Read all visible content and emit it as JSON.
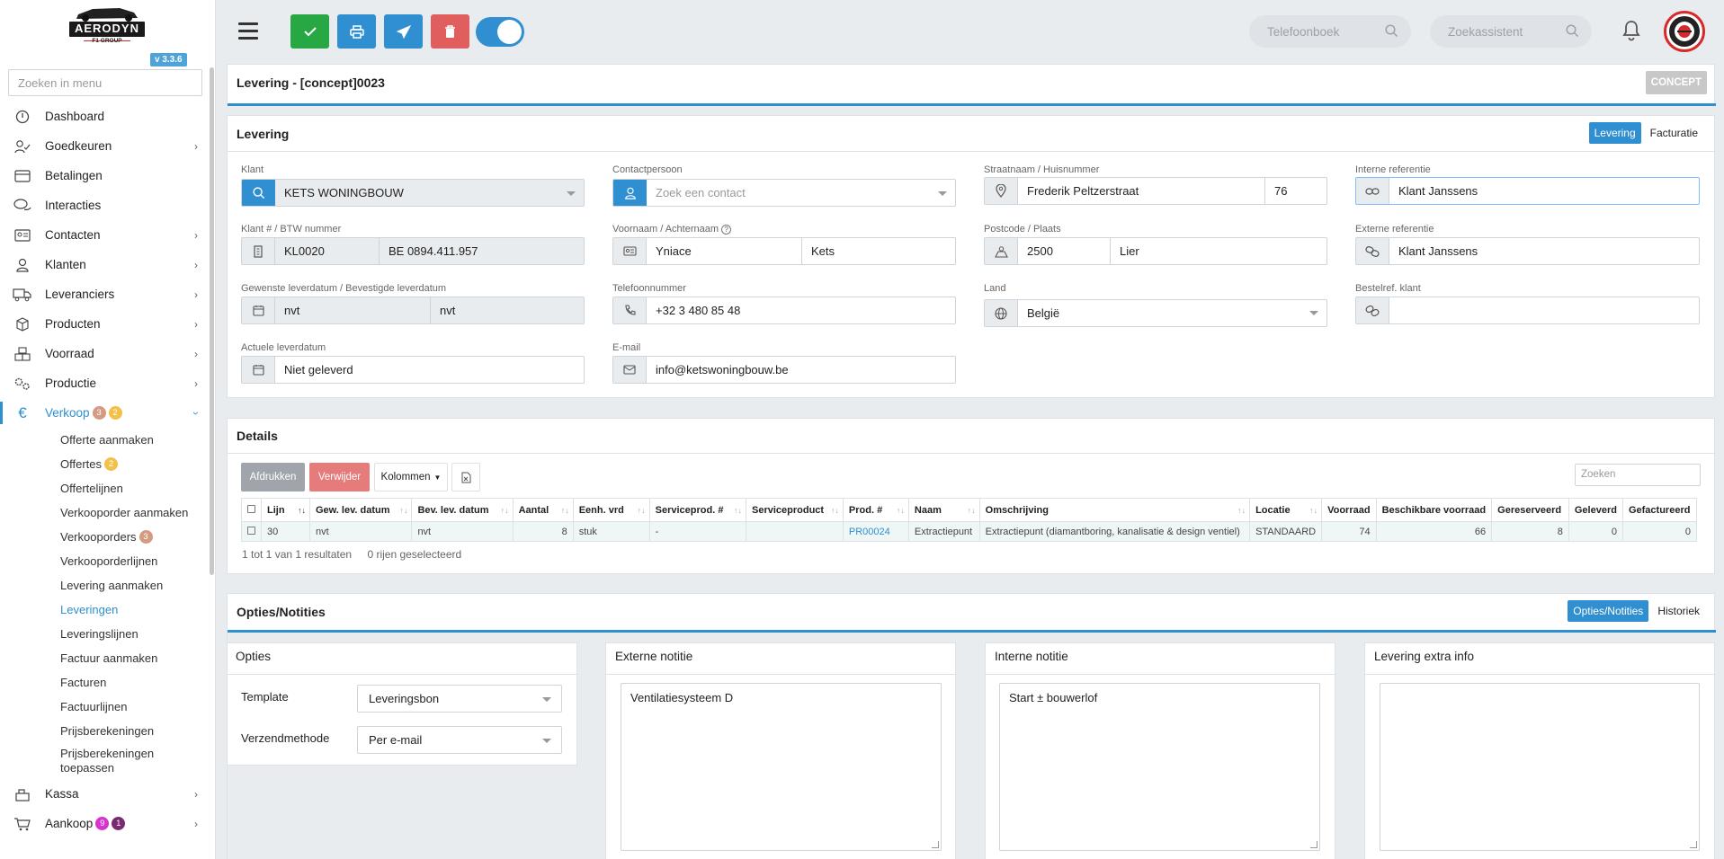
{
  "app": {
    "logo_text": "AERODYN",
    "logo_sub": "F1 GROUP",
    "version": "v 3.3.6",
    "menu_search_placeholder": "Zoeken in menu"
  },
  "nav": [
    {
      "label": "Dashboard",
      "icon": "dashboard-icon",
      "chevron": false
    },
    {
      "label": "Goedkeuren",
      "icon": "approve-user-icon",
      "chevron": true
    },
    {
      "label": "Betalingen",
      "icon": "credit-card-icon",
      "chevron": false
    },
    {
      "label": "Interacties",
      "icon": "chat-icon",
      "chevron": false
    },
    {
      "label": "Contacten",
      "icon": "contact-card-icon",
      "chevron": true
    },
    {
      "label": "Klanten",
      "icon": "user-icon",
      "chevron": true
    },
    {
      "label": "Leveranciers",
      "icon": "truck-icon",
      "chevron": true
    },
    {
      "label": "Producten",
      "icon": "box-icon",
      "chevron": true
    },
    {
      "label": "Voorraad",
      "icon": "boxes-icon",
      "chevron": true
    },
    {
      "label": "Productie",
      "icon": "gears-icon",
      "chevron": true
    }
  ],
  "verkoop": {
    "label": "Verkoop",
    "badge1": "3",
    "badge2": "2",
    "items": [
      {
        "label": "Offerte aanmaken"
      },
      {
        "label": "Offertes",
        "badge": "2",
        "badge_color": "yellow"
      },
      {
        "label": "Offertelijnen"
      },
      {
        "label": "Verkooporder aanmaken"
      },
      {
        "label": "Verkooporders",
        "badge": "3",
        "badge_color": "brown"
      },
      {
        "label": "Verkooporderlijnen"
      },
      {
        "label": "Levering aanmaken"
      },
      {
        "label": "Leveringen",
        "current": true
      },
      {
        "label": "Leveringslijnen"
      },
      {
        "label": "Factuur aanmaken"
      },
      {
        "label": "Facturen"
      },
      {
        "label": "Factuurlijnen"
      },
      {
        "label": "Prijsberekeningen"
      },
      {
        "label": "Prijsberekeningen toepassen"
      }
    ]
  },
  "nav_bottom": [
    {
      "label": "Kassa",
      "icon": "cash-register-icon"
    },
    {
      "label": "Aankoop",
      "icon": "cart-icon",
      "badge1": "9",
      "badge2": "1"
    }
  ],
  "topbar": {
    "phonebook_placeholder": "Telefoonboek",
    "assistant_placeholder": "Zoekassistent",
    "colors": {
      "green": "#28a745",
      "blue": "#2f8fd0",
      "red": "#e05e5e"
    }
  },
  "header": {
    "title": "Levering - [concept]0023",
    "status": "CONCEPT"
  },
  "levering": {
    "title": "Levering",
    "tab_levering": "Levering",
    "tab_facturatie": "Facturatie",
    "klant_label": "Klant",
    "klant_value": "KETS WONINGBOUW",
    "contact_label": "Contactpersoon",
    "contact_placeholder": "Zoek een contact",
    "straat_label": "Straatnaam / Huisnummer",
    "straat_value": "Frederik Peltzerstraat",
    "huisnummer_value": "76",
    "intref_label": "Interne referentie",
    "intref_value": "Klant Janssens",
    "klantnr_label": "Klant # / BTW nummer",
    "klantnr_value": "KL0020",
    "btw_value": "BE 0894.411.957",
    "naam_label": "Voornaam / Achternaam",
    "voornaam_value": "Yniace",
    "achternaam_value": "Kets",
    "postcode_label": "Postcode / Plaats",
    "postcode_value": "2500",
    "plaats_value": "Lier",
    "extref_label": "Externe referentie",
    "extref_value": "Klant Janssens",
    "datum_label": "Gewenste leverdatum / Bevestigde leverdatum",
    "gewenst_value": "nvt",
    "bevestigd_value": "nvt",
    "tel_label": "Telefoonnummer",
    "tel_value": "+32 3 480 85 48",
    "land_label": "Land",
    "land_value": "België",
    "bestelref_label": "Bestelref. klant",
    "bestelref_value": "",
    "actueel_label": "Actuele leverdatum",
    "actueel_value": "Niet geleverd",
    "email_label": "E-mail",
    "email_value": "info@ketswoningbouw.be"
  },
  "details": {
    "title": "Details",
    "btn_print": "Afdrukken",
    "btn_delete": "Verwijder",
    "btn_columns": "Kolommen",
    "search_placeholder": "Zoeken",
    "columns": [
      "Lijn",
      "Gew. lev. datum",
      "Bev. lev. datum",
      "Aantal",
      "Eenh. vrd",
      "Serviceprod. #",
      "Serviceproduct",
      "Prod. #",
      "Naam",
      "Omschrijving",
      "Locatie",
      "Voorraad",
      "Beschikbare voorraad",
      "Gereserveerd",
      "Geleverd",
      "Gefactureerd"
    ],
    "rows": [
      [
        "30",
        "nvt",
        "nvt",
        "8",
        "stuk",
        "-",
        "",
        "PR00024",
        "Extractiepunt",
        "Extractiepunt (diamantboring, kanalisatie & design ventiel)",
        "STANDAARD",
        "74",
        "66",
        "8",
        "0",
        "0"
      ]
    ],
    "footer_count": "1 tot 1 van 1 resultaten",
    "footer_selected": "0 rijen geselecteerd"
  },
  "opties": {
    "title": "Opties/Notities",
    "tab_opties": "Opties/Notities",
    "tab_historiek": "Historiek",
    "opties_title": "Opties",
    "template_label": "Template",
    "template_value": "Leveringsbon",
    "verzend_label": "Verzendmethode",
    "verzend_value": "Per e-mail",
    "ext_title": "Externe notitie",
    "ext_value": "Ventilatiesysteem D",
    "int_title": "Interne notitie",
    "int_value": "Start ± bouwerlof",
    "extra_title": "Levering extra info",
    "extra_value": ""
  }
}
